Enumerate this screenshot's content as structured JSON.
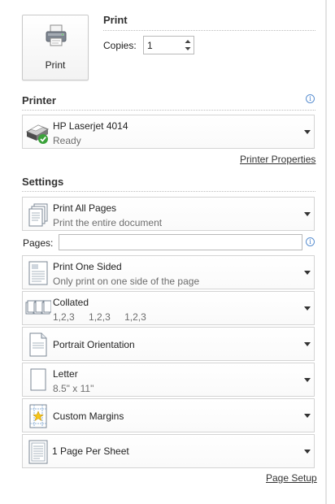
{
  "print_button": {
    "label": "Print",
    "icon": "printer-icon"
  },
  "print_section": {
    "heading": "Print",
    "copies_label": "Copies:",
    "copies_value": "1"
  },
  "printer_section": {
    "heading": "Printer",
    "info_icon": "info-icon",
    "selected": {
      "name": "HP Laserjet 4014",
      "status": "Ready",
      "icon": "printer-ready-icon"
    },
    "properties_link": "Printer Properties"
  },
  "settings_section": {
    "heading": "Settings",
    "pages_label": "Pages:",
    "pages_value": "",
    "pages_info_icon": "info-icon",
    "options": [
      {
        "title": "Print All Pages",
        "subtitle": "Print the entire document",
        "icon": "pages-stack-icon"
      },
      {
        "title": "Print One Sided",
        "subtitle": "Only print on one side of the page",
        "icon": "one-sided-icon"
      },
      {
        "title": "Collated",
        "subtitle_parts": [
          "1,2,3",
          "1,2,3",
          "1,2,3"
        ],
        "icon": "collated-icon"
      },
      {
        "title": "Portrait Orientation",
        "icon": "portrait-icon"
      },
      {
        "title": "Letter",
        "subtitle": "8.5\" x 11\"",
        "icon": "paper-size-icon"
      },
      {
        "title": "Custom Margins",
        "icon": "custom-margins-icon"
      },
      {
        "title": "1 Page Per Sheet",
        "icon": "pages-per-sheet-icon"
      }
    ],
    "page_setup_link": "Page Setup"
  },
  "colors": {
    "info_blue": "#3f7ccc",
    "border": "#d4d4d4",
    "check_green": "#3aa23a"
  }
}
